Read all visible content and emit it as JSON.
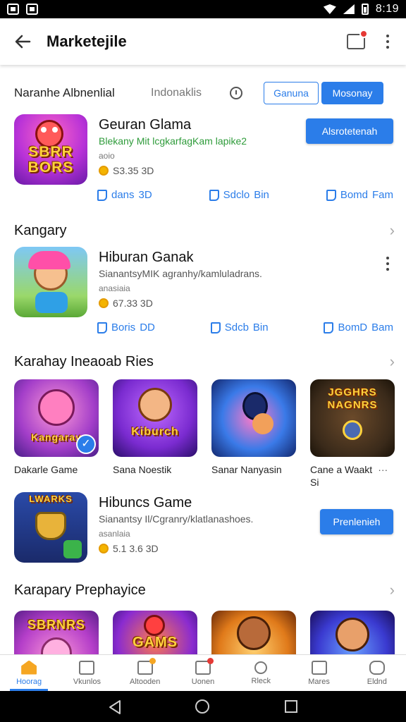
{
  "status_bar": {
    "time": "8:19"
  },
  "app_bar": {
    "title": "Marketejile"
  },
  "filter": {
    "label": "Naranhe Albnenlial",
    "sublabel": "Indonaklis",
    "button_outline": "Ganuna",
    "button_filled": "Mosonay"
  },
  "featured_app_1": {
    "name": "Geuran Glama",
    "description": "Blekany Mit lcgkarfagKam lapike2",
    "tag": "aoio",
    "rating": "S3.35 3D",
    "cta": "Alsrotetenah",
    "icon_text": "SBRR\nBORS",
    "actions": [
      "dans",
      "3D",
      "Sdclo",
      "Bin",
      "Bomd",
      "Fam"
    ]
  },
  "section_1": {
    "title": "Kangary"
  },
  "featured_app_2": {
    "name": "Hiburan Ganak",
    "description": "SianantsyMIK agranhy/kamluladrans.",
    "tag": "anasiaia",
    "rating": "67.33 3D",
    "actions": [
      "Boris",
      "DD",
      "Sdcb",
      "Bin",
      "BomD",
      "Bam"
    ]
  },
  "section_2": {
    "title": "Karahay Ineaoab Ries",
    "tiles": [
      {
        "label": "Dakarle Game",
        "art": "Kangaray"
      },
      {
        "label": "Sana Noestik",
        "art": "Kiburch"
      },
      {
        "label": "Sanar Nanyasin",
        "art": ""
      },
      {
        "label": "Cane a Waakt",
        "art": "JGGHRS NAGNRS",
        "extra": "Si"
      }
    ]
  },
  "featured_app_3": {
    "name": "Hibuncs Game",
    "description": "Sianantsy Il/Cgranry/klatlanashoes.",
    "tag": "asanlaia",
    "rating": "5.1 3.6  3D",
    "cta": "Prenlenieh",
    "icon_text": "LWARKS"
  },
  "section_3": {
    "title": "Karapary Prephayice",
    "tiles": [
      {
        "art": "SBRNRS"
      },
      {
        "art": "GAMS"
      },
      {
        "art": ""
      },
      {
        "art": ""
      }
    ]
  },
  "bottom_nav": [
    "Hoorag",
    "Vkunlos",
    "Altooden",
    "Uonen",
    "Rleck",
    "Mares",
    "Eldnd"
  ],
  "colors": {
    "accent": "#2b7de9",
    "badge": "#e53935",
    "coin": "#f4b400",
    "green_text": "#2e9b3a"
  }
}
